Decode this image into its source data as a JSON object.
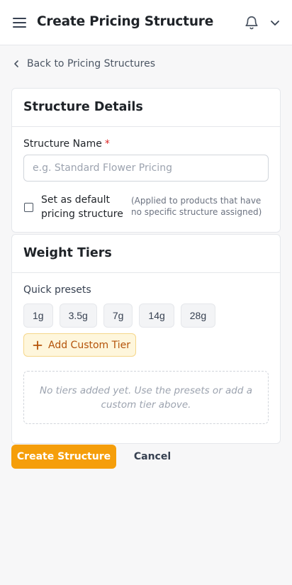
{
  "header": {
    "menu_icon": "hamburger-menu-icon",
    "title": "Create Pricing Structure",
    "notification_icon": "bell-icon",
    "account_icon": "chevron-down-icon"
  },
  "back_link": {
    "icon": "chevron-left-icon",
    "label": "Back to Pricing Structures"
  },
  "details": {
    "title": "Structure Details",
    "name_label": "Structure Name",
    "required_mark": "*",
    "name_placeholder": "e.g. Standard Flower Pricing",
    "name_value": "",
    "default_checked": false,
    "default_label": "Set as default pricing structure",
    "default_hint": "(Applied to products that have no specific structure assigned)"
  },
  "tiers": {
    "title": "Weight Tiers",
    "presets_label": "Quick presets",
    "presets": [
      "1g",
      "3.5g",
      "7g",
      "14g",
      "28g"
    ],
    "add_custom_label": "Add Custom Tier",
    "empty_message": "No tiers added yet. Use the presets or add a custom tier above."
  },
  "actions": {
    "create_label": "Create Structure",
    "cancel_label": "Cancel"
  },
  "colors": {
    "accent": "#f59e0b",
    "accent_text": "#b45309",
    "accent_soft": "#fef6dc",
    "required": "#dc2626"
  }
}
